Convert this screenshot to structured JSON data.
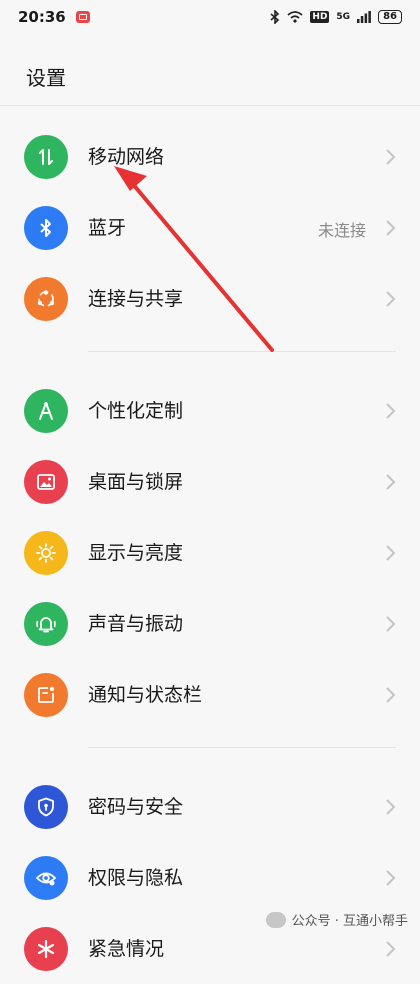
{
  "status_bar": {
    "time": "20:36",
    "hd_label": "HD",
    "network_label": "5G",
    "battery": "86"
  },
  "page": {
    "title": "设置"
  },
  "groups": [
    [
      {
        "label": "移动网络",
        "icon": "mobile-data-icon",
        "color": "#2fb55f",
        "value": ""
      },
      {
        "label": "蓝牙",
        "icon": "bluetooth-icon",
        "color": "#2d7cf6",
        "value": "未连接"
      },
      {
        "label": "连接与共享",
        "icon": "share-icon",
        "color": "#f27a2e",
        "value": ""
      }
    ],
    [
      {
        "label": "个性化定制",
        "icon": "compass-icon",
        "color": "#2fb55f",
        "value": ""
      },
      {
        "label": "桌面与锁屏",
        "icon": "picture-icon",
        "color": "#e8404e",
        "value": ""
      },
      {
        "label": "显示与亮度",
        "icon": "brightness-icon",
        "color": "#f5b719",
        "value": ""
      },
      {
        "label": "声音与振动",
        "icon": "bell-icon",
        "color": "#2fb55f",
        "value": ""
      },
      {
        "label": "通知与状态栏",
        "icon": "notification-icon",
        "color": "#f27a2e",
        "value": ""
      }
    ],
    [
      {
        "label": "密码与安全",
        "icon": "shield-icon",
        "color": "#2d57d6",
        "value": ""
      },
      {
        "label": "权限与隐私",
        "icon": "eye-icon",
        "color": "#2d7cf6",
        "value": ""
      },
      {
        "label": "紧急情况",
        "icon": "emergency-icon",
        "color": "#e8404e",
        "value": ""
      }
    ]
  ],
  "watermark": {
    "text": "公众号 · 互通小帮手"
  }
}
